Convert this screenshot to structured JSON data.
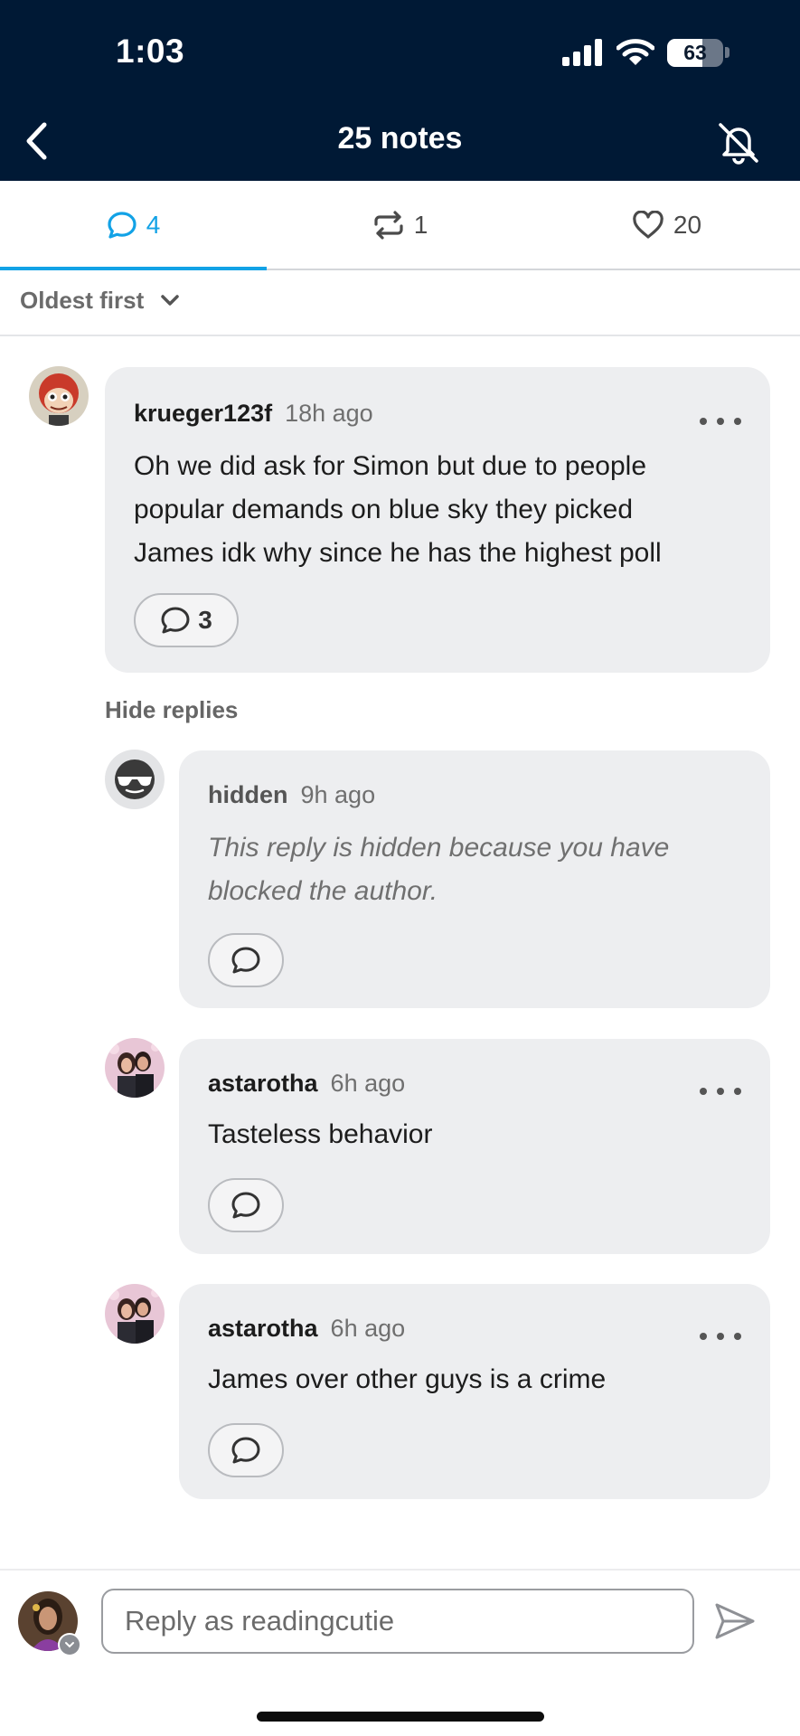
{
  "status_bar": {
    "time": "1:03",
    "battery": "63",
    "battery_level": 0.63,
    "icons": [
      "signal-icon",
      "wifi-icon",
      "battery-icon"
    ]
  },
  "nav": {
    "title": "25 notes",
    "back_icon": "chevron-left-icon",
    "mute_icon": "bell-off-icon"
  },
  "tabs": [
    {
      "icon": "comment-icon",
      "count": "4",
      "active": true
    },
    {
      "icon": "reblog-icon",
      "count": "1",
      "active": false
    },
    {
      "icon": "heart-icon",
      "count": "20",
      "active": false
    }
  ],
  "sort": {
    "label": "Oldest first",
    "icon": "chevron-down-icon"
  },
  "comments": [
    {
      "username": "krueger123f",
      "time": "18h ago",
      "lines": [
        "Oh we did ask for Simon but due to people",
        "popular demands on blue sky they picked",
        "James idk why since he has the highest poll"
      ],
      "reply_count": "3"
    }
  ],
  "hide_replies_label": "Hide replies",
  "replies": [
    {
      "username": "hidden",
      "time": "9h ago",
      "lines": [
        "This reply is hidden because you have",
        "blocked the author."
      ],
      "hidden": true
    },
    {
      "username": "astarotha",
      "time": "6h ago",
      "lines": [
        "Tasteless behavior"
      ]
    },
    {
      "username": "astarotha",
      "time": "6h ago",
      "lines": [
        "James over other guys is a crime"
      ]
    }
  ],
  "composer": {
    "placeholder": "Reply as readingcutie",
    "value": "",
    "send_icon": "send-icon"
  },
  "colors": {
    "header_bg": "#001935",
    "accent": "#12a2e6",
    "card_bg": "#edeef0"
  }
}
